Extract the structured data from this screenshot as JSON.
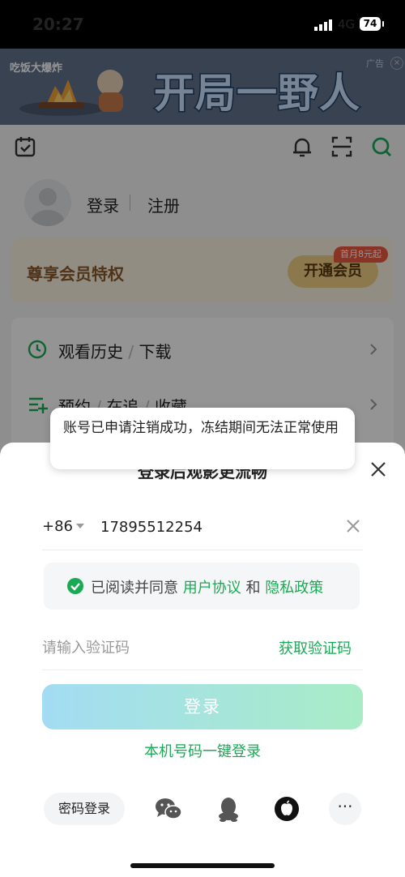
{
  "status_bar": {
    "time": "20:27",
    "network": "4G",
    "battery": "74"
  },
  "ad_banner": {
    "title": "开局一野人",
    "ad_tag": "广告",
    "game_logo_text": "吃饭大爆炸"
  },
  "top_icons": [
    "calendar-check-icon",
    "bell-icon",
    "scan-icon",
    "search-icon"
  ],
  "profile": {
    "login": "登录",
    "register": "注册"
  },
  "vip": {
    "title": "尊享会员特权",
    "button": "开通会员",
    "badge": "首月8元起"
  },
  "menu": [
    {
      "icon": "history-icon",
      "a": "观看历史",
      "b": "下载"
    },
    {
      "icon": "list-add-icon",
      "a": "预约",
      "b": "在追",
      "c": "收藏"
    }
  ],
  "sheet": {
    "title": "登录后观影更流畅",
    "country_code": "+86",
    "phone_value": "17895512254",
    "agreement": {
      "prefix": "已阅读并同意",
      "link1": "用户协议",
      "and": "和",
      "link2": "隐私政策"
    },
    "code_placeholder": "请输入验证码",
    "get_code": "获取验证码",
    "login_button": "登录",
    "one_key_login": "本机号码一键登录",
    "password_login": "密码登录",
    "social_icons": [
      "wechat-icon",
      "qq-icon",
      "apple-icon"
    ],
    "more": "···"
  },
  "toast": {
    "message": "账号已申请注销成功，冻结期间无法正常使用"
  },
  "colors": {
    "accent_green": "#1aaa55",
    "vip_gold": "#f1cf85",
    "badge_red": "#ec5840"
  }
}
